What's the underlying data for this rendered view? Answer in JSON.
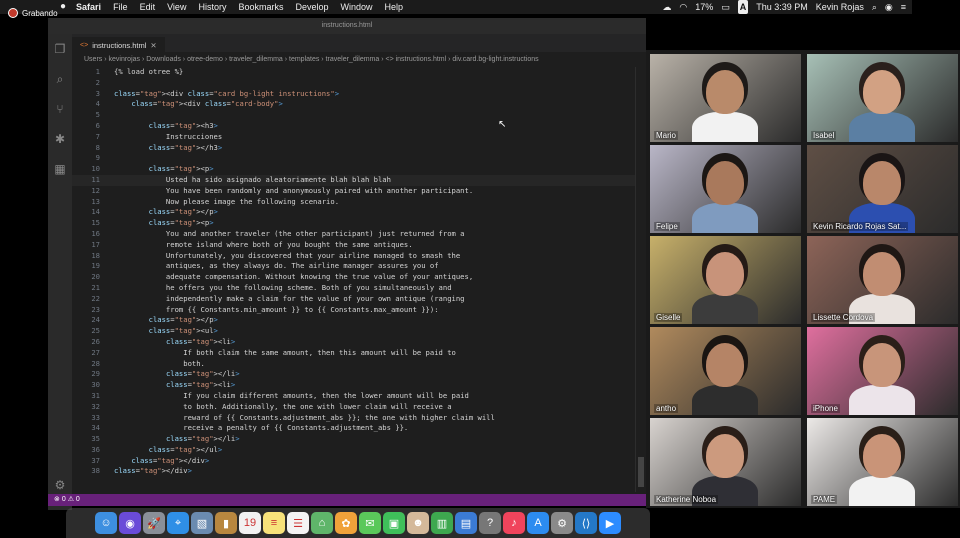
{
  "recording": {
    "label": "Grabando"
  },
  "menubar": {
    "app": "Safari",
    "items": [
      "File",
      "Edit",
      "View",
      "History",
      "Bookmarks",
      "Develop",
      "Window",
      "Help"
    ],
    "battery": "17%",
    "input_source": "A",
    "datetime": "Thu 3:39 PM",
    "user": "Kevin Rojas"
  },
  "editor": {
    "window_title": "instructions.html",
    "tab_label": "instructions.html",
    "breadcrumb": "Users › kevinrojas › Downloads › otree-demo › traveler_dilemma › templates › traveler_dilemma › <> instructions.html › div.card.bg-light.instructions",
    "lines": [
      "{% load otree %}",
      "",
      "<div class=\"card bg-light instructions\">",
      "    <div class=\"card-body\">",
      "",
      "        <h3>",
      "            Instrucciones",
      "        </h3>",
      "",
      "        <p>",
      "            Usted ha sido asignado aleatoriamente blah blah blah",
      "            You have been randomly and anonymously paired with another participant.",
      "            Now please image the following scenario.",
      "        </p>",
      "        <p>",
      "            You and another traveler (the other participant) just returned from a",
      "            remote island where both of you bought the same antiques.",
      "            Unfortunately, you discovered that your airline managed to smash the",
      "            antiques, as they always do. The airline manager assures you of",
      "            adequate compensation. Without knowing the true value of your antiques,",
      "            he offers you the following scheme. Both of you simultaneously and",
      "            independently make a claim for the value of your own antique (ranging",
      "            from {{ Constants.min_amount }} to {{ Constants.max_amount }}):",
      "        </p>",
      "        <ul>",
      "            <li>",
      "                If both claim the same amount, then this amount will be paid to",
      "                both.",
      "            </li>",
      "            <li>",
      "                If you claim different amounts, then the lower amount will be paid",
      "                to both. Additionally, the one with lower claim will receive a",
      "                reward of {{ Constants.adjustment_abs }}; the one with higher claim will",
      "                receive a penalty of {{ Constants.adjustment_abs }}.",
      "            </li>",
      "        </ul>",
      "    </div>",
      "</div>"
    ],
    "status": {
      "errors": "0",
      "warnings": "0"
    }
  },
  "participants": [
    {
      "name": "Mario",
      "bg": "#b9b2a8",
      "skin": "#b98a6a",
      "shirt": "#f2f2f2",
      "hair": "#1e1a18"
    },
    {
      "name": "Isabel",
      "bg": "#a7c0b6",
      "skin": "#d2a183",
      "shirt": "#5b7fa3",
      "hair": "#2a201c"
    },
    {
      "name": "Felipe",
      "bg": "#b9b6c7",
      "skin": "#a9795c",
      "shirt": "#7f9bbf",
      "hair": "#1c1714"
    },
    {
      "name": "Kevin Ricardo Rojas Sat...",
      "bg": "#5f4f45",
      "skin": "#b9876a",
      "shirt": "#2c4fb0",
      "hair": "#1a1515"
    },
    {
      "name": "Giselle",
      "bg": "#c7b06a",
      "skin": "#c8937a",
      "shirt": "#3c3c3c",
      "hair": "#241a16"
    },
    {
      "name": "Lissette Cordova",
      "bg": "#8d6458",
      "skin": "#c18d72",
      "shirt": "#e9e2de",
      "hair": "#1f1714"
    },
    {
      "name": "antho",
      "bg": "#b08a5d",
      "skin": "#b58466",
      "shirt": "#2d2d2d",
      "hair": "#1a1512"
    },
    {
      "name": "iPhone",
      "bg": "#df6f9e",
      "skin": "#c8957a",
      "shirt": "#ece4ea",
      "hair": "#2b1f19"
    },
    {
      "name": "Katherine Noboa",
      "bg": "#d8d3cf",
      "skin": "#cc9a7e",
      "shirt": "#2f2f35",
      "hair": "#2a1e18"
    },
    {
      "name": "PAME",
      "bg": "#ece9e7",
      "skin": "#c99478",
      "shirt": "#f2f2f2",
      "hair": "#2a1f18"
    }
  ],
  "dock": [
    {
      "name": "finder-icon",
      "color": "#3d8fe0"
    },
    {
      "name": "siri-icon",
      "color": "#6a4bd8"
    },
    {
      "name": "launchpad-icon",
      "color": "#8a8f98"
    },
    {
      "name": "safari-icon",
      "color": "#2f8fe6"
    },
    {
      "name": "photos-preview-icon",
      "color": "#6a8bb0"
    },
    {
      "name": "notebook-icon",
      "color": "#b8873f"
    },
    {
      "name": "calendar-icon",
      "color": "#f2f2f2"
    },
    {
      "name": "notes-icon",
      "color": "#f7e27a"
    },
    {
      "name": "reminders-icon",
      "color": "#f4f4f4"
    },
    {
      "name": "maps-icon",
      "color": "#5fb56a"
    },
    {
      "name": "photos-icon",
      "color": "#f0a23a"
    },
    {
      "name": "messages-icon",
      "color": "#5ac85a"
    },
    {
      "name": "facetime-icon",
      "color": "#3fbf5a"
    },
    {
      "name": "contacts-icon",
      "color": "#d4b99a"
    },
    {
      "name": "numbers-icon",
      "color": "#3ea84f"
    },
    {
      "name": "keynote-icon",
      "color": "#3b7bd4"
    },
    {
      "name": "help-icon",
      "color": "#777777"
    },
    {
      "name": "music-icon",
      "color": "#f0445c"
    },
    {
      "name": "app-store-icon",
      "color": "#2c8cf0"
    },
    {
      "name": "system-preferences-icon",
      "color": "#8a8a8a"
    },
    {
      "name": "vscode-icon",
      "color": "#2478c7"
    },
    {
      "name": "zoom-icon",
      "color": "#2d8cff"
    }
  ]
}
